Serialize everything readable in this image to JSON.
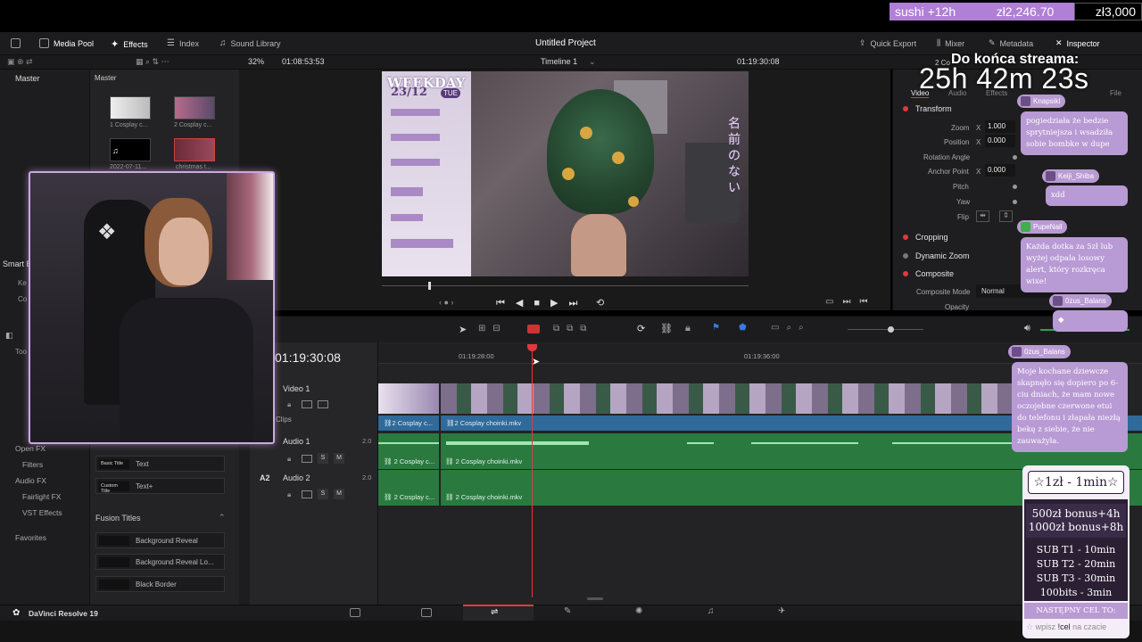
{
  "stream_bar": {
    "goal_name": "sushi +12h",
    "current_amount": "zł2,246.70",
    "target_amount": "zł3,000",
    "progress_fraction": 0.749
  },
  "menu": {
    "media_pool": "Media Pool",
    "effects": "Effects",
    "index": "Index",
    "sound_library": "Sound Library",
    "project_title": "Untitled Project",
    "quick_export": "Quick Export",
    "mixer": "Mixer",
    "metadata": "Metadata",
    "inspector": "Inspector"
  },
  "viewer_toolbar": {
    "zoom": "32%",
    "source_timecode": "01:08:53:53",
    "timeline_name": "Timeline 1",
    "record_timecode": "01:19:30:08"
  },
  "media_pool": {
    "master_left": "Master",
    "master_right": "Master",
    "clips": [
      {
        "name": "1 Cosplay c..."
      },
      {
        "name": "2 Cosplay c..."
      },
      {
        "name": "2022-07-11..."
      },
      {
        "name": "christmas t..."
      }
    ]
  },
  "effects_panel": {
    "smart_bins": "Smart B",
    "keywords": "Ke",
    "collections": "Co",
    "toolbox": "Too",
    "open_fx": "Open FX",
    "filters": "Filters",
    "audio_fx": "Audio FX",
    "fairlight_fx": "Fairlight FX",
    "vst_effects": "VST Effects",
    "favorites": "Favorites",
    "titles": [
      {
        "thumb": "Basic Title",
        "label": "Text"
      },
      {
        "thumb": "Custom Title",
        "label": "Text+"
      }
    ],
    "fusion_titles_header": "Fusion Titles",
    "fusion_titles": [
      {
        "label": "Background Reveal"
      },
      {
        "label": "Background Reveal Lo..."
      },
      {
        "label": "Black Border"
      }
    ]
  },
  "inspector": {
    "tab_video": "Video",
    "tab_audio": "Audio",
    "tab_effects": "Effects",
    "tab_file": "File",
    "clip_name": "2 Co",
    "transform": "Transform",
    "zoom_label": "Zoom",
    "zoom_x": "1.000",
    "position_label": "Position",
    "position_x": "0.000",
    "rotation_label": "Rotation Angle",
    "anchor_label": "Anchor Point",
    "anchor_x": "0.000",
    "pitch_label": "Pitch",
    "yaw_label": "Yaw",
    "flip_label": "Flip",
    "axis_x": "X",
    "cropping": "Cropping",
    "dynamic_zoom": "Dynamic Zoom",
    "composite": "Composite",
    "composite_mode_label": "Composite Mode",
    "composite_mode_value": "Normal",
    "opacity_label": "Opacity"
  },
  "timeline": {
    "timecode": "01:19:30:08",
    "ruler_1": "01:19:28:00",
    "ruler_2": "01:19:36:00",
    "video_track": "Video 1",
    "clips_label": "Clips",
    "audio_track_1": "Audio 1",
    "audio_track_2_code": "A2",
    "audio_track_2": "Audio 2",
    "channel_1": "2.0",
    "channel_2": "2.0",
    "solo": "S",
    "mute": "M",
    "clip_short": "2 Cosplay c...",
    "clip_full": "2 Cosplay choinki.mkv"
  },
  "app": {
    "name": "DaVinci Resolve 19"
  },
  "overlay": {
    "countdown_label": "Do końca streama:",
    "countdown": "25h 42m 23s",
    "video_text": {
      "weekday": "WEEKDAY",
      "date": "23/12",
      "day": "TUE",
      "japanese": "名前のない"
    },
    "chat": [
      {
        "user": "Knapsikl",
        "text": "pogiedziała że bedzie sprytniejsza i wsadziła sobie bombke w dupe"
      },
      {
        "user": "Keiji_Shiba",
        "text": "xdd"
      },
      {
        "user": "PupeNail",
        "text": "Każda dotka za 5zł lub wyżej odpala losowy alert, który rozkręca wixe!"
      },
      {
        "user": "0zus_Balans",
        "text": ""
      },
      {
        "user": "0zus_Balans",
        "text": "Moje kochane dziewcze skapnęło się dopiero po 6-ciu dniach, że mam nowe oczojebne czerwone etui do telefonu i złapała niezłą bekę z siebie, że nie zauważyła."
      }
    ],
    "goal_box": {
      "rate": "☆1zł - 1min☆",
      "bonus_1": "500zł bonus+4h",
      "bonus_2": "1000zł bonus+8h",
      "sub_1": "SUB T1 - 10min",
      "sub_2": "SUB T2 - 20min",
      "sub_3": "SUB T3 - 30min",
      "bits": "100bits - 3min",
      "next_goal": "NASTĘPNY CEL TO:",
      "cta_prefix": "wpisz",
      "cta_cmd": "!cel",
      "cta_suffix": "na czacie"
    }
  }
}
